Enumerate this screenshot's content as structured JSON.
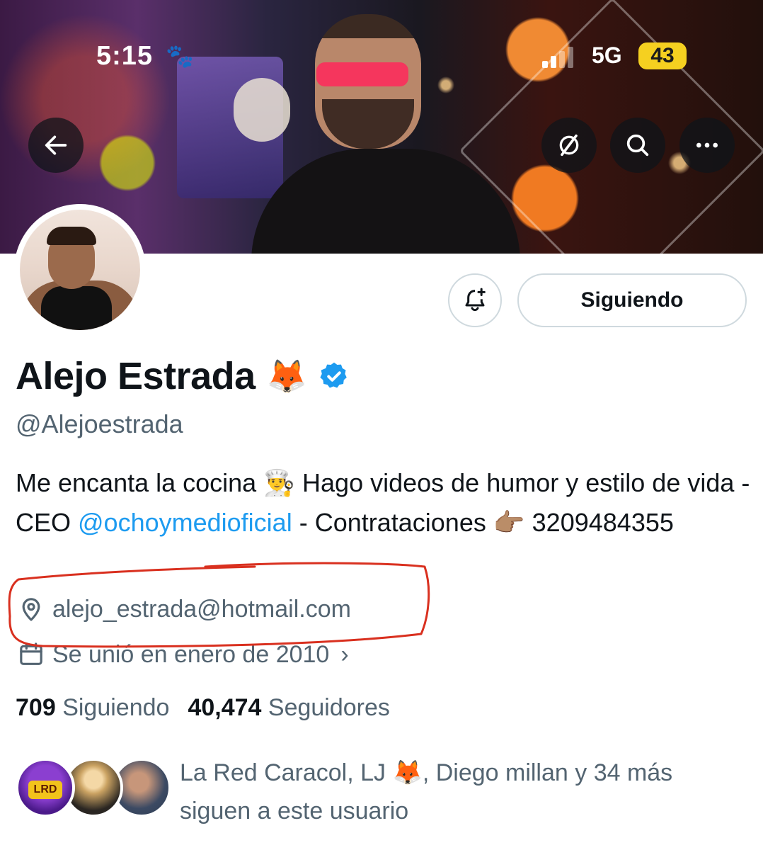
{
  "status_bar": {
    "time": "5:15",
    "focus_icon": "paw-icon",
    "network": "5G",
    "battery": "43"
  },
  "header_buttons": {
    "back": "arrow-left-icon",
    "grok": "grok-slash-icon",
    "search": "search-icon",
    "more": "more-horizontal-icon"
  },
  "actions": {
    "notify_icon": "bell-plus-icon",
    "follow_label": "Siguiendo"
  },
  "profile": {
    "name": "Alejo Estrada",
    "name_emoji": "🦊",
    "handle": "@Alejoestrada",
    "bio_part1": "Me encanta la cocina 👨‍🍳 Hago videos de humor y estilo de vida - CEO ",
    "bio_mention": "@ochoymedioficial",
    "bio_part2": " - Contrataciones 👉🏽 3209484355",
    "location": "alejo_estrada@hotmail.com",
    "joined": "Se unió en enero de 2010"
  },
  "stats": {
    "following_count": "709",
    "following_label": "Siguiendo",
    "followers_count": "40,474",
    "followers_label": "Seguidores"
  },
  "followed_by": {
    "badge_text": "LRD",
    "text": "La Red Caracol, LJ 🦊, Diego millan y 34 más siguen a este usuario"
  },
  "colors": {
    "link": "#1d9bf0",
    "secondary_text": "#536471",
    "annotation": "#d9301f",
    "battery": "#f5d020"
  }
}
